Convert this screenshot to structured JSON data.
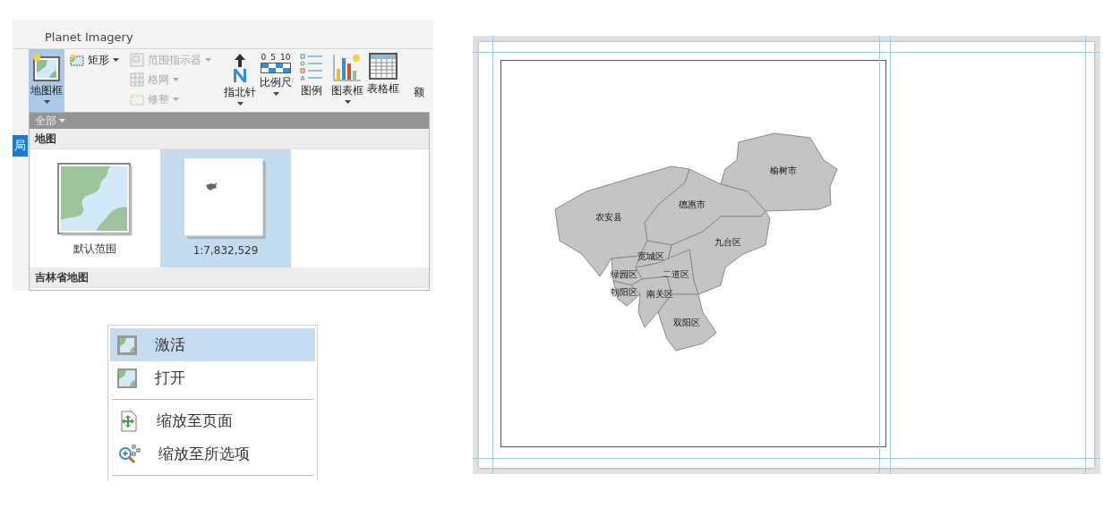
{
  "ribbon": {
    "tab_label": "Planet Imagery",
    "map_tool": {
      "kind": "map_frame",
      "label": "地图框",
      "selected": true,
      "dropdown": true
    },
    "small_columns": [
      [
        {
          "kind": "rectangle",
          "label": "矩形",
          "disabled": false,
          "dropdown": true
        }
      ],
      [
        {
          "kind": "extent_indicator",
          "label": "范围指示器",
          "disabled": true,
          "dropdown": true
        },
        {
          "kind": "grid",
          "label": "格网",
          "disabled": true,
          "dropdown": true
        },
        {
          "kind": "reshape",
          "label": "修整",
          "disabled": true,
          "dropdown": true
        }
      ]
    ],
    "large_tools": [
      {
        "kind": "north_arrow",
        "label": "指北针",
        "selected": false,
        "dropdown": true
      },
      {
        "kind": "scale_bar",
        "label": "比例尺",
        "selected": false,
        "dropdown": true,
        "ticks": [
          "0",
          "5",
          "10"
        ]
      },
      {
        "kind": "legend",
        "label": "图例",
        "selected": false,
        "dropdown": false
      },
      {
        "kind": "chart_frame",
        "label": "图表框",
        "selected": false,
        "dropdown": true
      },
      {
        "kind": "table_frame",
        "label": "表格框",
        "selected": false,
        "dropdown": false
      },
      {
        "kind": "partial",
        "label": "额",
        "selected": false,
        "dropdown": false
      }
    ],
    "side_tab": "局",
    "gallery": {
      "filter": "全部",
      "sections": [
        {
          "title": "地图",
          "items": [
            {
              "kind": "default_extent",
              "label": "默认范围",
              "selected": false
            },
            {
              "kind": "current_view",
              "label": "1:7,832,529",
              "selected": true
            }
          ]
        },
        {
          "title": "吉林省地图"
        }
      ]
    }
  },
  "context_menu": {
    "groups": [
      [
        {
          "kind": "activate",
          "label": "激活",
          "selected": true
        },
        {
          "kind": "open",
          "label": "打开",
          "selected": false
        }
      ],
      [
        {
          "kind": "zoom_page",
          "label": "缩放至页面",
          "selected": false
        },
        {
          "kind": "zoom_selected",
          "label": "缩放至所选项",
          "selected": false
        }
      ]
    ]
  },
  "layout": {
    "map_labels": [
      "榆树市",
      "德惠市",
      "农安县",
      "九台区",
      "宽城区",
      "绿园区",
      "二道区",
      "朝阳区",
      "南关区",
      "双阳区"
    ]
  }
}
